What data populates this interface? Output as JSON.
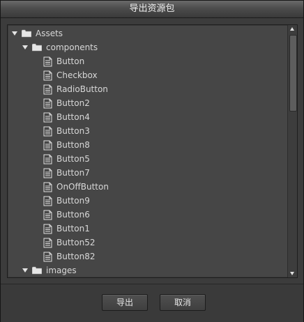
{
  "dialog": {
    "title": "导出资源包"
  },
  "tree": {
    "root": {
      "label": "Assets",
      "icon": "folder-icon",
      "expanded": true
    },
    "components": {
      "label": "components",
      "icon": "folder-icon",
      "expanded": true
    },
    "files": [
      "Button",
      "Checkbox",
      "RadioButton",
      "Button2",
      "Button4",
      "Button3",
      "Button8",
      "Button5",
      "Button7",
      "OnOffButton",
      "Button9",
      "Button6",
      "Button1",
      "Button52",
      "Button82"
    ],
    "images": {
      "label": "images",
      "icon": "folder-icon",
      "expanded": true
    }
  },
  "footer": {
    "export_label": "导出",
    "cancel_label": "取消"
  }
}
